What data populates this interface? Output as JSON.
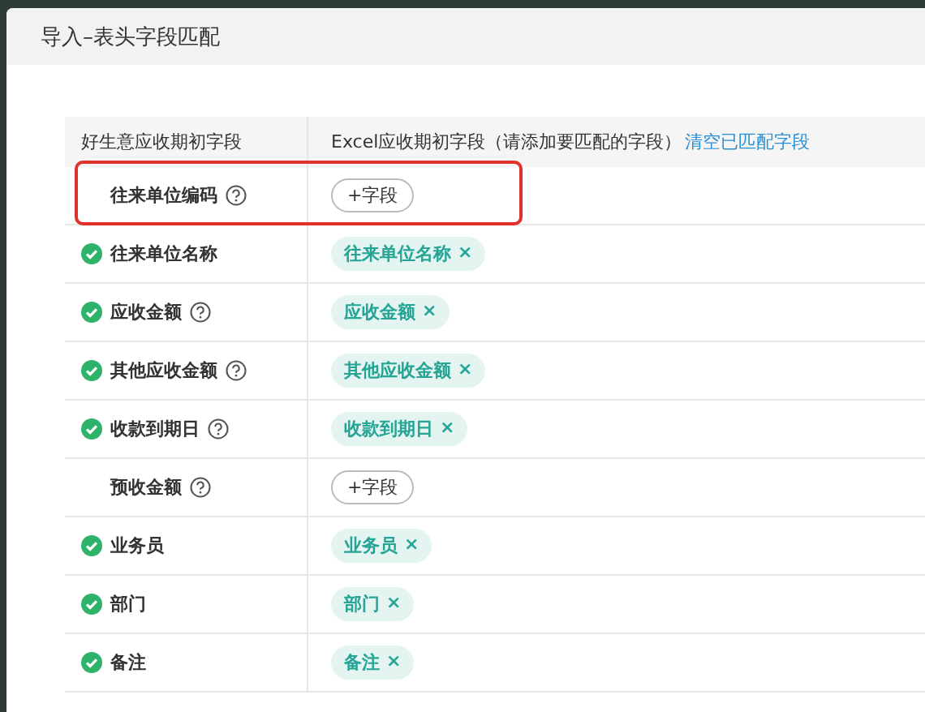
{
  "dialog": {
    "title": "导入–表头字段匹配"
  },
  "table": {
    "columns": [
      "好生意应收期初字段",
      "Excel应收期初字段（请添加要匹配的字段）"
    ],
    "clear_link": "清空已匹配字段",
    "rows": [
      {
        "label": "往来单位编码",
        "matched": false,
        "help": true,
        "highlighted": true,
        "field": {
          "kind": "add",
          "label": "+字段"
        }
      },
      {
        "label": "往来单位名称",
        "matched": true,
        "help": false,
        "highlighted": false,
        "field": {
          "kind": "tag",
          "label": "往来单位名称",
          "remove": "×"
        }
      },
      {
        "label": "应收金额",
        "matched": true,
        "help": true,
        "highlighted": false,
        "field": {
          "kind": "tag",
          "label": "应收金额",
          "remove": "×"
        }
      },
      {
        "label": "其他应收金额",
        "matched": true,
        "help": true,
        "highlighted": false,
        "field": {
          "kind": "tag",
          "label": "其他应收金额",
          "remove": "×"
        }
      },
      {
        "label": "收款到期日",
        "matched": true,
        "help": true,
        "highlighted": false,
        "field": {
          "kind": "tag",
          "label": "收款到期日",
          "remove": "×"
        }
      },
      {
        "label": "预收金额",
        "matched": false,
        "help": true,
        "highlighted": false,
        "field": {
          "kind": "add",
          "label": "+字段"
        }
      },
      {
        "label": "业务员",
        "matched": true,
        "help": false,
        "highlighted": false,
        "field": {
          "kind": "tag",
          "label": "业务员",
          "remove": "×"
        }
      },
      {
        "label": "部门",
        "matched": true,
        "help": false,
        "highlighted": false,
        "field": {
          "kind": "tag",
          "label": "部门",
          "remove": "×"
        }
      },
      {
        "label": "备注",
        "matched": true,
        "help": false,
        "highlighted": false,
        "field": {
          "kind": "tag",
          "label": "备注",
          "remove": "×"
        }
      }
    ]
  }
}
